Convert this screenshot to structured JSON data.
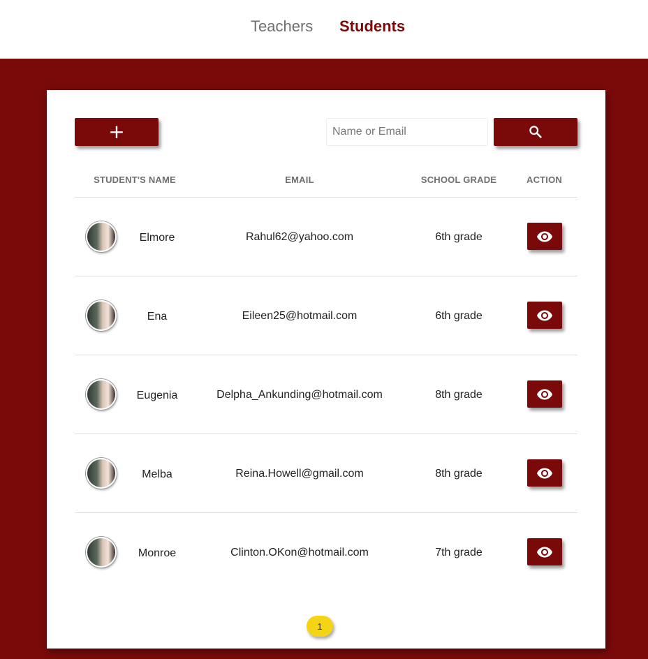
{
  "nav": {
    "tabs": [
      {
        "label": "Teachers",
        "active": false
      },
      {
        "label": "Students",
        "active": true
      }
    ]
  },
  "toolbar": {
    "add_label": "+",
    "search_placeholder": "Name or Email",
    "search_icon": "search-icon"
  },
  "table": {
    "headers": [
      "STUDENT'S NAME",
      "EMAIL",
      "SCHOOL GRADE",
      "ACTION"
    ],
    "rows": [
      {
        "name": "Elmore",
        "email": "Rahul62@yahoo.com",
        "grade": "6th grade"
      },
      {
        "name": "Ena",
        "email": "Eileen25@hotmail.com",
        "grade": "6th grade"
      },
      {
        "name": "Eugenia",
        "email": "Delpha_Ankunding@hotmail.com",
        "grade": "8th grade"
      },
      {
        "name": "Melba",
        "email": "Reina.Howell@gmail.com",
        "grade": "8th grade"
      },
      {
        "name": "Monroe",
        "email": "Clinton.OKon@hotmail.com",
        "grade": "7th grade"
      }
    ],
    "action_icon": "eye-icon"
  },
  "pagination": {
    "current": "1"
  },
  "colors": {
    "brand": "#7a0a0a",
    "page_chip": "#f5d315",
    "background": "#ffffff"
  }
}
